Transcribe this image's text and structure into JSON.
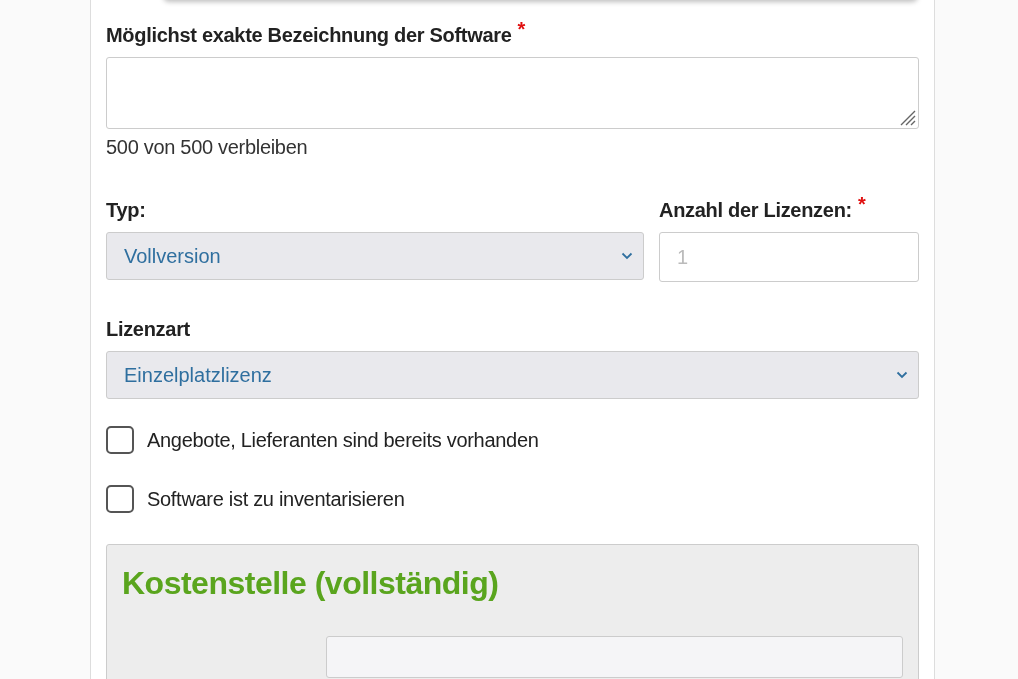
{
  "software_name": {
    "label": "Möglichst exakte Bezeichnung der Software",
    "required_mark": "*",
    "counter": "500 von 500 verbleiben"
  },
  "typ": {
    "label": "Typ:",
    "value": "Vollversion"
  },
  "licenses": {
    "label": "Anzahl der Lizenzen:",
    "required_mark": "*",
    "placeholder": "1"
  },
  "license_type": {
    "label": "Lizenzart",
    "value": "Einzelplatzlizenz"
  },
  "checkboxes": [
    {
      "label": "Angebote, Lieferanten sind bereits vorhanden",
      "checked": false
    },
    {
      "label": "Software ist zu inventarisieren",
      "checked": false
    }
  ],
  "cost_center": {
    "title": "Kostenstelle (vollständig)"
  }
}
